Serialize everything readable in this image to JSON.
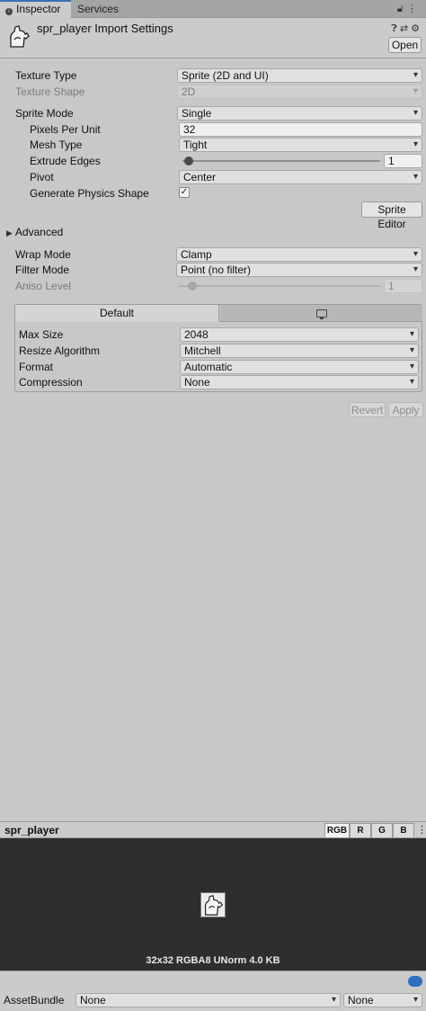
{
  "tabs": {
    "inspector": "Inspector",
    "services": "Services"
  },
  "header": {
    "title": "spr_player Import Settings",
    "open_label": "Open"
  },
  "importer": {
    "texture_type": {
      "label": "Texture Type",
      "value": "Sprite (2D and UI)"
    },
    "texture_shape": {
      "label": "Texture Shape",
      "value": "2D"
    },
    "sprite_mode": {
      "label": "Sprite Mode",
      "value": "Single"
    },
    "pixels_per_unit": {
      "label": "Pixels Per Unit",
      "value": "32"
    },
    "mesh_type": {
      "label": "Mesh Type",
      "value": "Tight"
    },
    "extrude_edges": {
      "label": "Extrude Edges",
      "value": "1"
    },
    "pivot": {
      "label": "Pivot",
      "value": "Center"
    },
    "generate_physics_shape": {
      "label": "Generate Physics Shape",
      "checked": true
    },
    "sprite_editor_label": "Sprite Editor",
    "advanced_label": "Advanced",
    "wrap_mode": {
      "label": "Wrap Mode",
      "value": "Clamp"
    },
    "filter_mode": {
      "label": "Filter Mode",
      "value": "Point (no filter)"
    },
    "aniso_level": {
      "label": "Aniso Level",
      "value": "1"
    }
  },
  "platform": {
    "tabs": {
      "default": "Default"
    },
    "max_size": {
      "label": "Max Size",
      "value": "2048"
    },
    "resize_algorithm": {
      "label": "Resize Algorithm",
      "value": "Mitchell"
    },
    "format": {
      "label": "Format",
      "value": "Automatic"
    },
    "compression": {
      "label": "Compression",
      "value": "None"
    }
  },
  "actions": {
    "revert": "Revert",
    "apply": "Apply"
  },
  "preview": {
    "title": "spr_player",
    "channels": [
      "RGB",
      "R",
      "G",
      "B"
    ],
    "info": "32x32  RGBA8 UNorm   4.0 KB"
  },
  "asset_bundle": {
    "label": "AssetBundle",
    "name_value": "None",
    "variant_value": "None"
  }
}
